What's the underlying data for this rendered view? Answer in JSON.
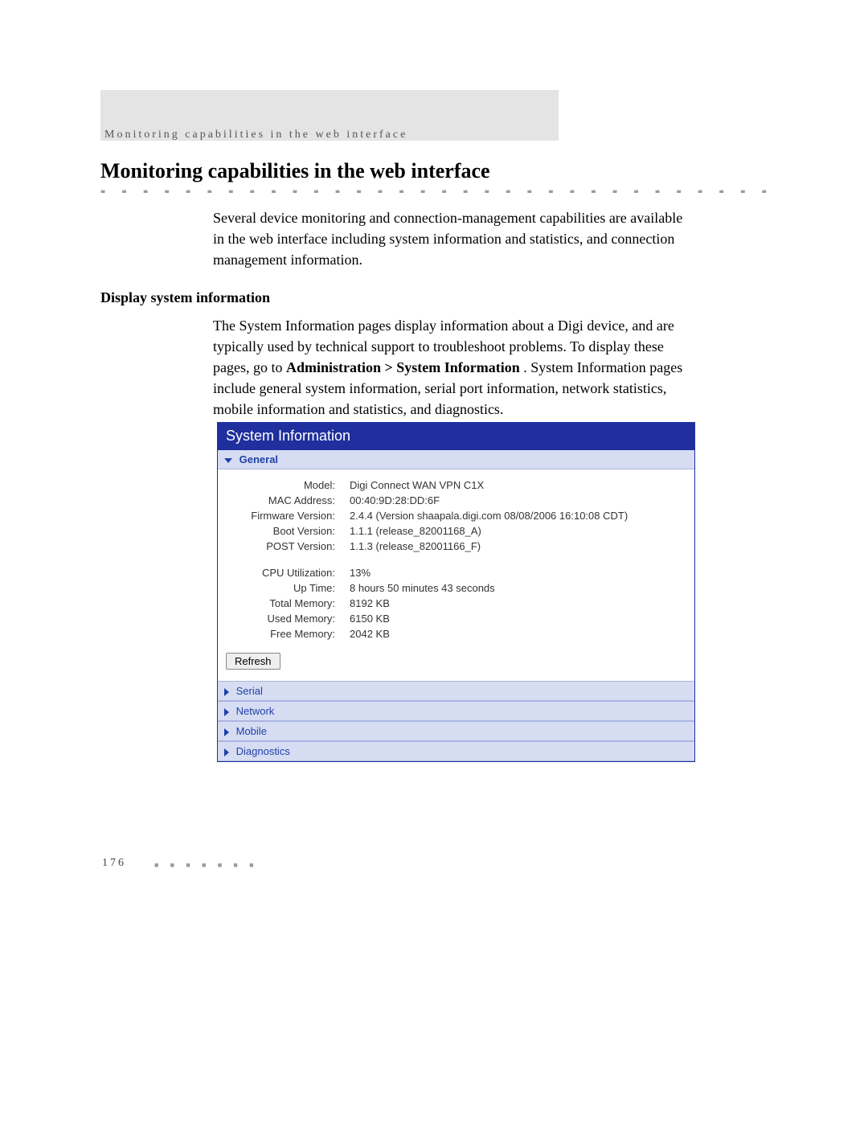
{
  "running_head": "Monitoring capabilities in the web interface",
  "section_title": "Monitoring capabilities in the web interface",
  "intro": "Several device monitoring and connection-management capabilities are available in the web interface including system information and statistics, and connection management information.",
  "subsection_title": "Display system information",
  "body_before_bold": "The System Information pages display information about a Digi device, and are typically used by technical support to troubleshoot problems. To display these pages, go to ",
  "body_bold": "Administration > System Information",
  "body_after_bold": ". System Information pages include general system information, serial port information, network statistics, mobile information and statistics, and diagnostics.",
  "panel": {
    "title": "System Information",
    "sections": {
      "general": "General",
      "serial": "Serial",
      "network": "Network",
      "mobile": "Mobile",
      "diagnostics": "Diagnostics"
    },
    "general_rows": {
      "model_k": "Model:",
      "model_v": "Digi Connect WAN VPN C1X",
      "mac_k": "MAC Address:",
      "mac_v": "00:40:9D:28:DD:6F",
      "fw_k": "Firmware Version:",
      "fw_v": "2.4.4  (Version shaapala.digi.com 08/08/2006 16:10:08 CDT)",
      "boot_k": "Boot Version:",
      "boot_v": "1.1.1  (release_82001168_A)",
      "post_k": "POST Version:",
      "post_v": "1.1.3  (release_82001166_F)",
      "cpu_k": "CPU Utilization:",
      "cpu_v": "13%",
      "up_k": "Up Time:",
      "up_v": "8 hours 50 minutes 43 seconds",
      "tmem_k": "Total Memory:",
      "tmem_v": "8192 KB",
      "umem_k": "Used Memory:",
      "umem_v": "6150 KB",
      "fmem_k": "Free Memory:",
      "fmem_v": "2042 KB"
    },
    "refresh": "Refresh"
  },
  "page_number": "176",
  "dot_pattern": "■ ■ ■ ■ ■ ■ ■ ■ ■ ■ ■ ■ ■ ■ ■ ■ ■ ■ ■ ■ ■ ■ ■ ■ ■ ■ ■ ■ ■ ■ ■ ■ ■ ■ ■ ■ ■ ■ ■ ■ ■ ■ ■ ■ ■ ■ ■ ■ ■ ■ ■ ■ ■ ■ ■ ■ ■ ■ ■ ■",
  "foot_dots": "■ ■ ■ ■ ■ ■ ■"
}
